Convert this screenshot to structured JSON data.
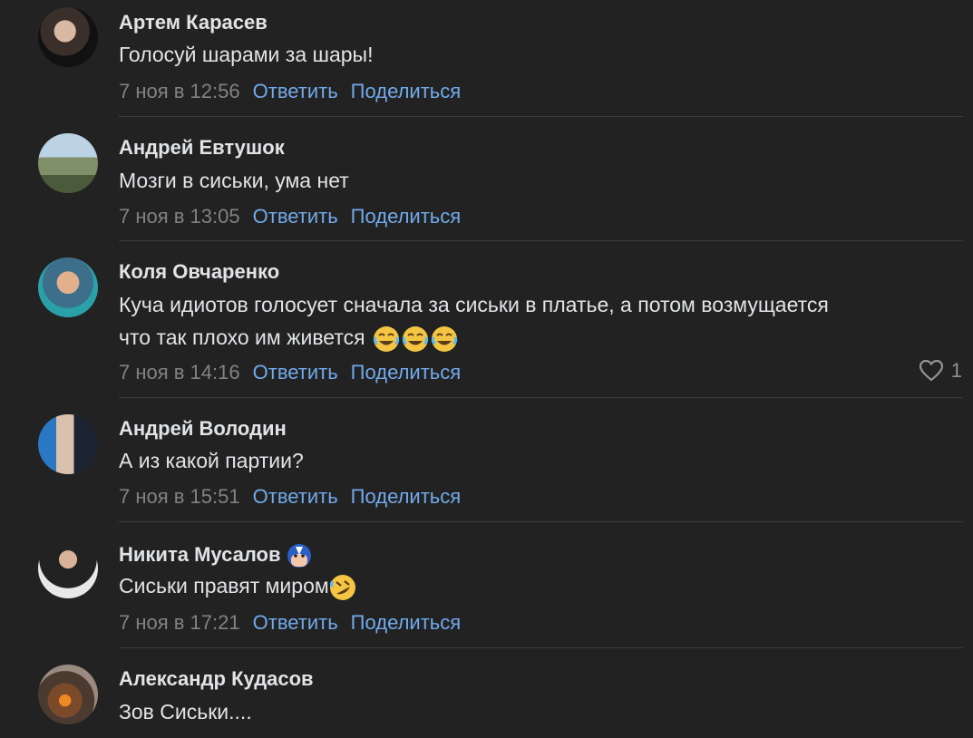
{
  "comments": [
    {
      "author": "Артем Карасев",
      "text": "Голосуй шарами за шары!",
      "time": "7 ноя в 12:56",
      "reply": "Ответить",
      "share": "Поделиться"
    },
    {
      "author": "Андрей Евтушок",
      "text": "Мозги в сиськи, ума нет",
      "time": "7 ноя в 13:05",
      "reply": "Ответить",
      "share": "Поделиться"
    },
    {
      "author": "Коля Овчаренко",
      "text_line1": "Куча идиотов голосует сначала за сиськи в платье, а потом возмущается",
      "text_line2": "что так плохо им живется",
      "time": "7 ноя в 14:16",
      "reply": "Ответить",
      "share": "Поделиться",
      "likes": "1"
    },
    {
      "author": "Андрей Володин",
      "text": "А из какой партии?",
      "time": "7 ноя в 15:51",
      "reply": "Ответить",
      "share": "Поделиться"
    },
    {
      "author": "Никита Мусалов",
      "text": "Сиськи правят миром",
      "time": "7 ноя в 17:21",
      "reply": "Ответить",
      "share": "Поделиться"
    },
    {
      "author": "Александр Кудасов",
      "text": "Зов Сиськи...."
    }
  ],
  "colors": {
    "background": "#222222",
    "text": "#e1e3e6",
    "link": "#71aaeb",
    "muted": "#828282"
  },
  "icons": {
    "like": "heart-outline-icon",
    "tears_of_joy": "face-with-tears-of-joy-emoji",
    "rofl": "rolling-on-floor-laughing-emoji",
    "badge": "captain-america-mask-icon"
  }
}
